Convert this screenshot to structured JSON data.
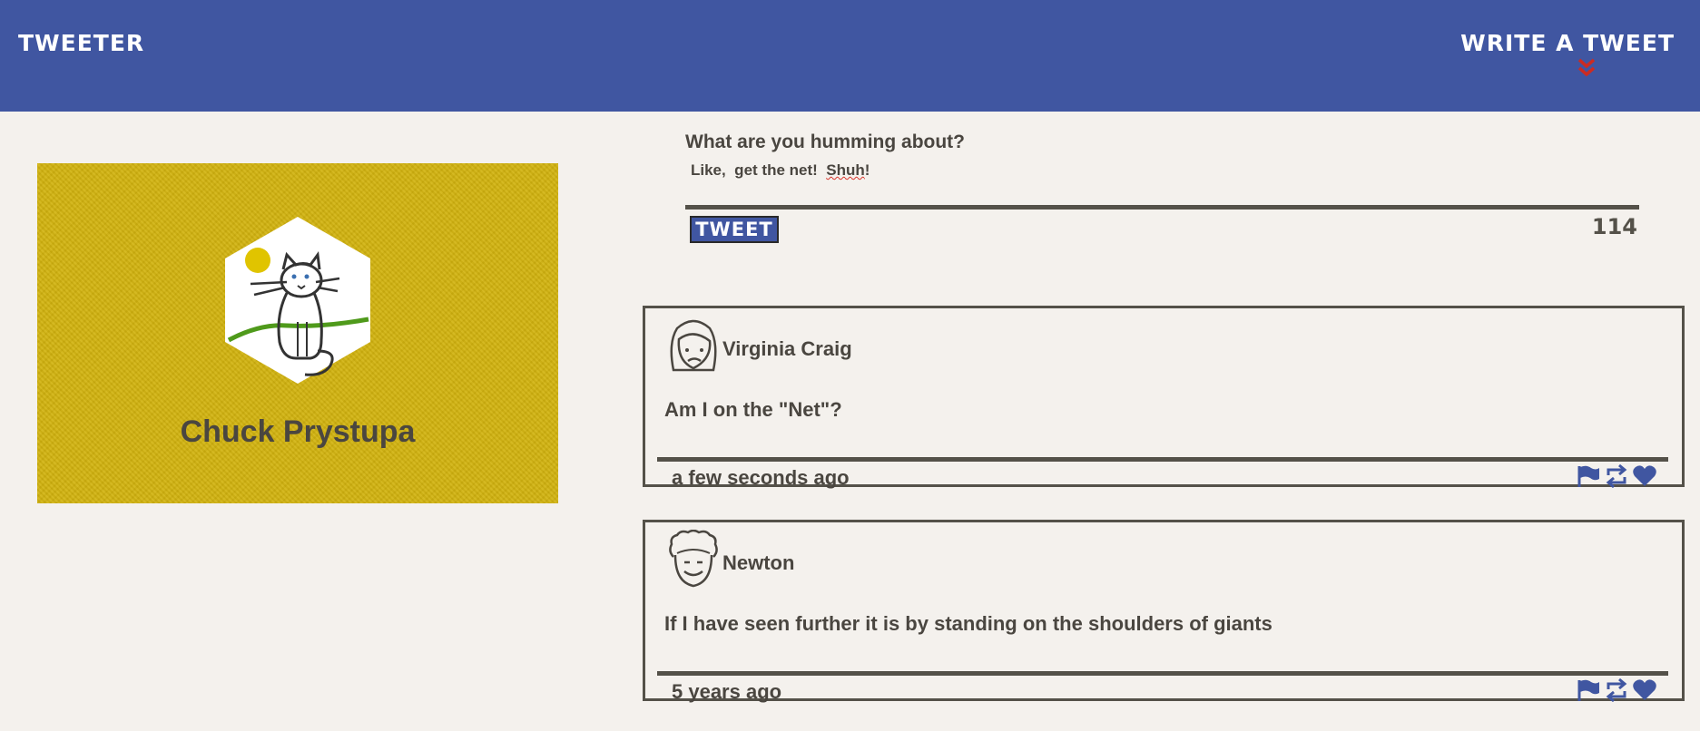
{
  "header": {
    "brand": "TWEETER",
    "write_label": "WRITE A TWEET",
    "write_icon": "double-chevron-down-icon",
    "accent": "#4056a1",
    "chevron_color": "#cc2b22"
  },
  "profile": {
    "name": "Chuck Prystupa",
    "card_color": "#d2b30e",
    "avatar_icon": "cat-drawing-avatar"
  },
  "compose": {
    "prompt": "What are you humming about?",
    "draft_parts": [
      "Like,  get the net!  ",
      "Shuh",
      "!"
    ],
    "button_label": "TWEET",
    "char_count": "114"
  },
  "tweets": [
    {
      "author": "Virginia Craig",
      "avatar_icon": "woman-face-avatar",
      "body": "Am I on the \"Net\"?",
      "time": "a few seconds ago",
      "actions": [
        "flag-icon",
        "retweet-icon",
        "heart-icon"
      ]
    },
    {
      "author": "Newton",
      "avatar_icon": "curly-hair-face-avatar",
      "body": "If I have seen further it is by standing on the shoulders of giants",
      "time": "5 years ago",
      "actions": [
        "flag-icon",
        "retweet-icon",
        "heart-icon"
      ]
    }
  ]
}
